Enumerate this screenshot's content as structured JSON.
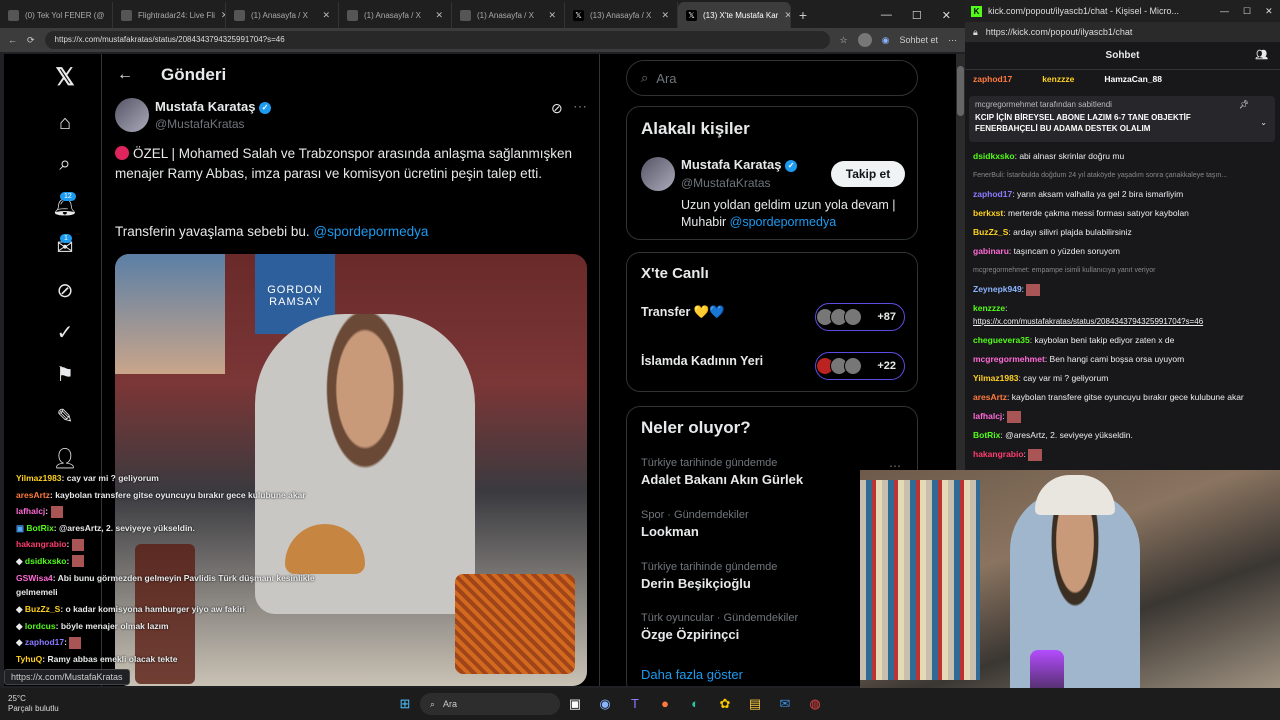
{
  "browser": {
    "tabs": [
      {
        "label": "(0) Tek Yol FENER (@"
      },
      {
        "label": "Flightradar24: Live Fli"
      },
      {
        "label": "(1) Anasayfa / X"
      },
      {
        "label": "(1) Anasayfa / X"
      },
      {
        "label": "(1) Anasayfa / X"
      },
      {
        "label": "(13) Anasayfa / X"
      },
      {
        "label": "(13) X'te Mustafa Kar"
      }
    ],
    "url": "https://x.com/mustafakratas/status/2084343794325991704?s=46",
    "sohbet_et": "Sohbet et",
    "status_url": "https://x.com/MustafaKratas"
  },
  "xpage": {
    "header_title": "Gönderi",
    "notif_badge": "12",
    "msg_badge": "1",
    "post": {
      "author": "Mustafa Karataş",
      "handle": "@MustafaKratas",
      "text1": "ÖZEL | Mohamed Salah ve Trabzonspor arasında anlaşma sağlanmışken menajer Ramy Abbas, imza parası ve komisyon ücretini peşin talep etti.",
      "text2": "Transferin yavaşlama sebebi bu.",
      "mention": "@spordepormedya",
      "photo_sign1": "GORDON",
      "photo_sign2": "RAMSAY"
    },
    "search_placeholder": "Ara",
    "related": {
      "title": "Alakalı kişiler",
      "name": "Mustafa Karataş",
      "handle": "@MustafaKratas",
      "follow": "Takip et",
      "bio": "Uzun yoldan geldim uzun yola devam | Muhabir",
      "bio_link": "@spordepormedya"
    },
    "live": {
      "title": "X'te Canlı",
      "items": [
        {
          "label": "Transfer 💛💙",
          "count": "+87"
        },
        {
          "label": "İslamda Kadının Yeri",
          "count": "+22"
        }
      ]
    },
    "trends": {
      "title": "Neler oluyor?",
      "items": [
        {
          "cat": "Türkiye tarihinde gündemde",
          "name": "Adalet Bakanı Akın Gürlek"
        },
        {
          "cat": "Spor · Gündemdekiler",
          "name": "Lookman"
        },
        {
          "cat": "Türkiye tarihinde gündemde",
          "name": "Derin Beşikçioğlu"
        },
        {
          "cat": "Türk oyuncular · Gündemdekiler",
          "name": "Özge Özpirinçci"
        }
      ],
      "more": "Daha fazla göster"
    }
  },
  "overlay_chat": [
    {
      "user": "Yilmaz1983",
      "text": "cay var mi ? geliyorum",
      "color": "#ffd21f"
    },
    {
      "user": "aresArtz",
      "text": "kaybolan transfere gitse oyuncuyu bırakır gece kulubune akar",
      "color": "#ff7a3d"
    },
    {
      "user": "lafhalcj",
      "text": "",
      "color": "#ff6ad5"
    },
    {
      "user": "BotRix",
      "text": "@aresArtz, 2. seviyeye yükseldin.",
      "color": "#53fc18"
    },
    {
      "user": "hakangrabio",
      "text": "",
      "color": "#ff3d6e"
    },
    {
      "user": "dsidkxsko",
      "text": "",
      "color": "#53fc18"
    },
    {
      "user": "GSWisa4",
      "text": "Abi bunu görmezden gelmeyin Pavlidis Türk düşmanı kesinlikle gelmemeli",
      "color": "#ff6ad5"
    },
    {
      "user": "BuzZz_S",
      "text": "o kadar komisyona hamburger yiyo aw fakiri",
      "color": "#ffd21f"
    },
    {
      "user": "lordcus",
      "text": "böyle menajer olmak lazım",
      "color": "#53fc18"
    },
    {
      "user": "zaphod17",
      "text": "",
      "color": "#8a7bff"
    },
    {
      "user": "TyhuQ",
      "text": "Ramy abbas emekli olacak tekte",
      "color": "#ffd21f"
    }
  ],
  "kick": {
    "title": "kick.com/popout/ilyascb1/chat - Kişisel - Micro...",
    "url": "https://kick.com/popout/ilyascb1/chat",
    "header": "Sohbet",
    "top_users": [
      "zaphod17",
      "kenzzze",
      "HamzaCan_88"
    ],
    "pinned_by": "mcgregormehmet tarafından sabitlendi",
    "pinned_text": "KCIP İÇİN BİREYSEL ABONE LAZIM 6-7 TANE OBJEKTİF FENERBAHÇELİ BU ADAMA DESTEK OLALIM",
    "messages": [
      {
        "user": "dsidkxsko",
        "text": "abi alnasr skrinlar doğru mu",
        "color": "#53fc18"
      },
      {
        "user": "",
        "text": "FenerBuli: İstanbulda doğdum 24 yıl ataköyde yaşadım sonra çanakkaleye taşın...",
        "color": "#888"
      },
      {
        "user": "zaphod17",
        "text": "yarın aksam valhalla ya gel 2 bira ismarliyim",
        "color": "#8a7bff"
      },
      {
        "user": "berkxst",
        "text": "merterde çakma messi forması satıyor kaybolan",
        "color": "#ffd21f"
      },
      {
        "user": "BuzZz_S",
        "text": "ardayı silivri plajda bulabilirsiniz",
        "color": "#ffd21f"
      },
      {
        "user": "gabinaru",
        "text": "taşıncam o yüzden soruyom",
        "color": "#ff6ad5"
      },
      {
        "user": "",
        "text": "mcgregormehmet: empampe isimli kullanıcıya yanıt veriyor",
        "color": "#888"
      },
      {
        "user": "Zeynepk949",
        "text": "",
        "color": "#8ab4ff"
      },
      {
        "user": "kenzzze",
        "text": "https://x.com/mustafakratas/status/2084343794325991704?s=46",
        "color": "#53fc18"
      },
      {
        "user": "cheguevera35",
        "text": "kaybolan beni takip ediyor zaten x de",
        "color": "#53fc18"
      },
      {
        "user": "mcgregormehmet",
        "text": "Ben hangi cami boşsa orsa uyuyom",
        "color": "#ff6ad5"
      },
      {
        "user": "Yilmaz1983",
        "text": "cay var mi ? geliyorum",
        "color": "#ffd21f"
      },
      {
        "user": "aresArtz",
        "text": "kaybolan transfere gitse oyuncuyu bırakır gece kulubune akar",
        "color": "#ff7a3d"
      },
      {
        "user": "lafhalcj",
        "text": "",
        "color": "#ff6ad5"
      },
      {
        "user": "BotRix",
        "text": "@aresArtz, 2. seviyeye yükseldin.",
        "color": "#53fc18"
      },
      {
        "user": "hakangrabio",
        "text": "",
        "color": "#ff3d6e"
      }
    ]
  },
  "taskbar": {
    "weather_temp": "25°C",
    "weather_desc": "Parçalı bulutlu",
    "search": "Ara"
  }
}
